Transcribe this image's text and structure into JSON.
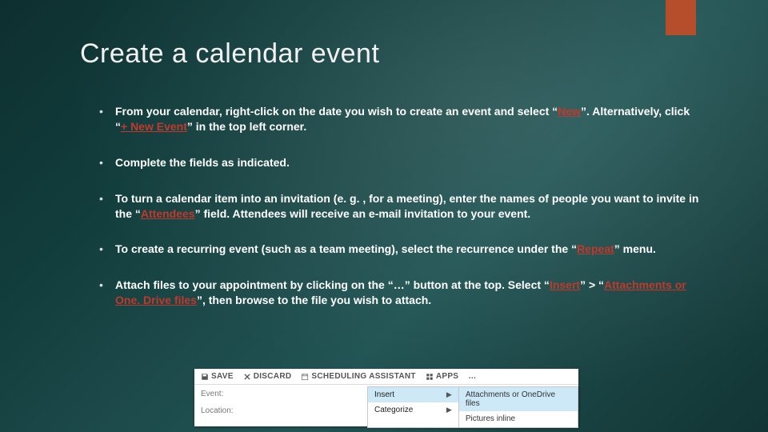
{
  "title": "Create a calendar event",
  "bullets": {
    "b1_a": "From your calendar, right-click on the date you wish to create an event and select “",
    "b1_new": "New",
    "b1_b": "”. Alternatively, click “",
    "b1_plus_new_event": "+ New Event",
    "b1_c": "” in the top left corner.",
    "b2": "Complete the fields as indicated.",
    "b3_a": "To turn a calendar item into an ",
    "b3_invitation": "invitation",
    "b3_b": " (e. g. , for a meeting), enter the names of people you want to invite in the “",
    "b3_attendees": "Attendees",
    "b3_c": "” field. Attendees will receive an e-mail invitation to your event.",
    "b4_a": "To create a ",
    "b4_recurring": "recurring event",
    "b4_b": " (such as a team meeting), select the recurrence under the “",
    "b4_repeat": "Repeat",
    "b4_c": "” menu.",
    "b5_a": "Attach files",
    "b5_b": " to your appointment by clicking on the “",
    "b5_dots": "…",
    "b5_c": "” button at the top. Select “",
    "b5_insert": "Insert",
    "b5_d": "” > “",
    "b5_attach": "Attachments or One. Drive files",
    "b5_e": "”, then browse to the file you wish to attach."
  },
  "inset": {
    "toolbar": {
      "save": "SAVE",
      "discard": "DISCARD",
      "sched": "SCHEDULING ASSISTANT",
      "apps": "APPS",
      "more": "…"
    },
    "labels": {
      "event": "Event:",
      "location": "Location:"
    },
    "menu": {
      "insert": "Insert",
      "categorize": "Categorize"
    },
    "submenu": {
      "attachments": "Attachments or OneDrive files",
      "pictures": "Pictures inline"
    }
  }
}
